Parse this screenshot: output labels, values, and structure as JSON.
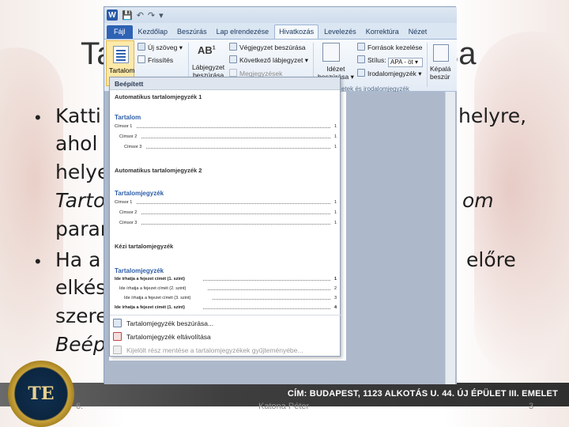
{
  "slide": {
    "title_left": "Ta",
    "title_right": "sa",
    "lines": [
      {
        "text": "Katti",
        "style": "normal"
      },
      {
        "text": "ahol",
        "style": "normal"
      },
      {
        "text": "helye",
        "style": "normal"
      },
      {
        "text": "Tarto",
        "style": "italic"
      },
      {
        "text": "param",
        "style": "normal"
      },
      {
        "text": "Ha a",
        "style": "normal"
      },
      {
        "text": "elkés",
        "style": "normal"
      },
      {
        "text": "szere",
        "style": "normal"
      },
      {
        "text": "Beép",
        "style": "italic"
      }
    ],
    "right_fragments": {
      "r1": "helyre,",
      "r2": "om",
      "r3": "előre"
    },
    "footer": {
      "address": "CÍM: BUDAPEST, 1123 ALKOTÁS U. 44. ÚJ ÉPÜLET III. EMELET",
      "date_fragment": "6.",
      "author": "Katona Péter",
      "page_number": "3",
      "logo_text": "TE"
    }
  },
  "word": {
    "quick_access": [
      "W",
      "💾",
      "↶",
      "↷",
      "▾"
    ],
    "tabs": [
      "Fájl",
      "Kezdőlap",
      "Beszúrás",
      "Lap elrendezése",
      "Hivatkozás",
      "Levelezés",
      "Korrektúra",
      "Nézet"
    ],
    "active_tab": "Hivatkozás",
    "ribbon": {
      "toc_label": "Tartalom",
      "new_text": "Új szöveg",
      "refresh": "Frissítés",
      "footnote_insert_1": "Lábjegyzet",
      "footnote_insert_2": "beszúrása",
      "endnote_insert": "Végjegyzet beszúrása",
      "next_footnote": "Következő lábjegyzet",
      "show_notes": "Megjegyzések",
      "citation_insert_1": "Idézet",
      "citation_insert_2": "beszúrása",
      "manage_sources": "Források kezelése",
      "style_label": "Stílus:",
      "style_value": "APA - öt",
      "bibliography": "Irodalomjegyzék",
      "caption_insert_1": "Képalá",
      "caption_insert_2": "beszúr",
      "group_citations": "etek és irodalomjegyzék"
    },
    "dropdown": {
      "header": "Beépített",
      "auto1_title": "Automatikus tartalomjegyzék 1",
      "auto1_heading": "Tartalom",
      "auto1_lines": [
        {
          "text": "Címsor 1",
          "page": "1"
        },
        {
          "text": "Címsor 2",
          "page": "1"
        },
        {
          "text": "Címsor 3",
          "page": "1"
        }
      ],
      "auto2_title": "Automatikus tartalomjegyzék 2",
      "auto2_heading": "Tartalomjegyzék",
      "auto2_lines": [
        {
          "text": "Címsor 1",
          "page": "1"
        },
        {
          "text": "Címsor 2",
          "page": "1"
        },
        {
          "text": "Címsor 3",
          "page": "1"
        }
      ],
      "manual_title": "Kézi tartalomjegyzék",
      "manual_heading": "Tartalomjegyzék",
      "manual_lines": [
        {
          "text": "Ide írhatja a fejezet címét (1. szint)",
          "page": "1"
        },
        {
          "text": "Ide írhatja a fejezet címét (2. szint)",
          "page": "2"
        },
        {
          "text": "Ide írhatja a fejezet címét (3. szint)",
          "page": "3"
        },
        {
          "text": "Ide írhatja a fejezet címét (1. szint)",
          "page": "4"
        }
      ],
      "cmd_insert": "Tartalomjegyzék beszúrása...",
      "cmd_remove": "Tartalomjegyzék eltávolítása",
      "cmd_save": "Kijelölt rész mentése a tartalomjegyzékek gyűjteményébe..."
    }
  },
  "colors": {
    "word_blue": "#2e62b4",
    "heading_blue": "#2e5ea8",
    "footer_dark": "#2f2f2f"
  }
}
